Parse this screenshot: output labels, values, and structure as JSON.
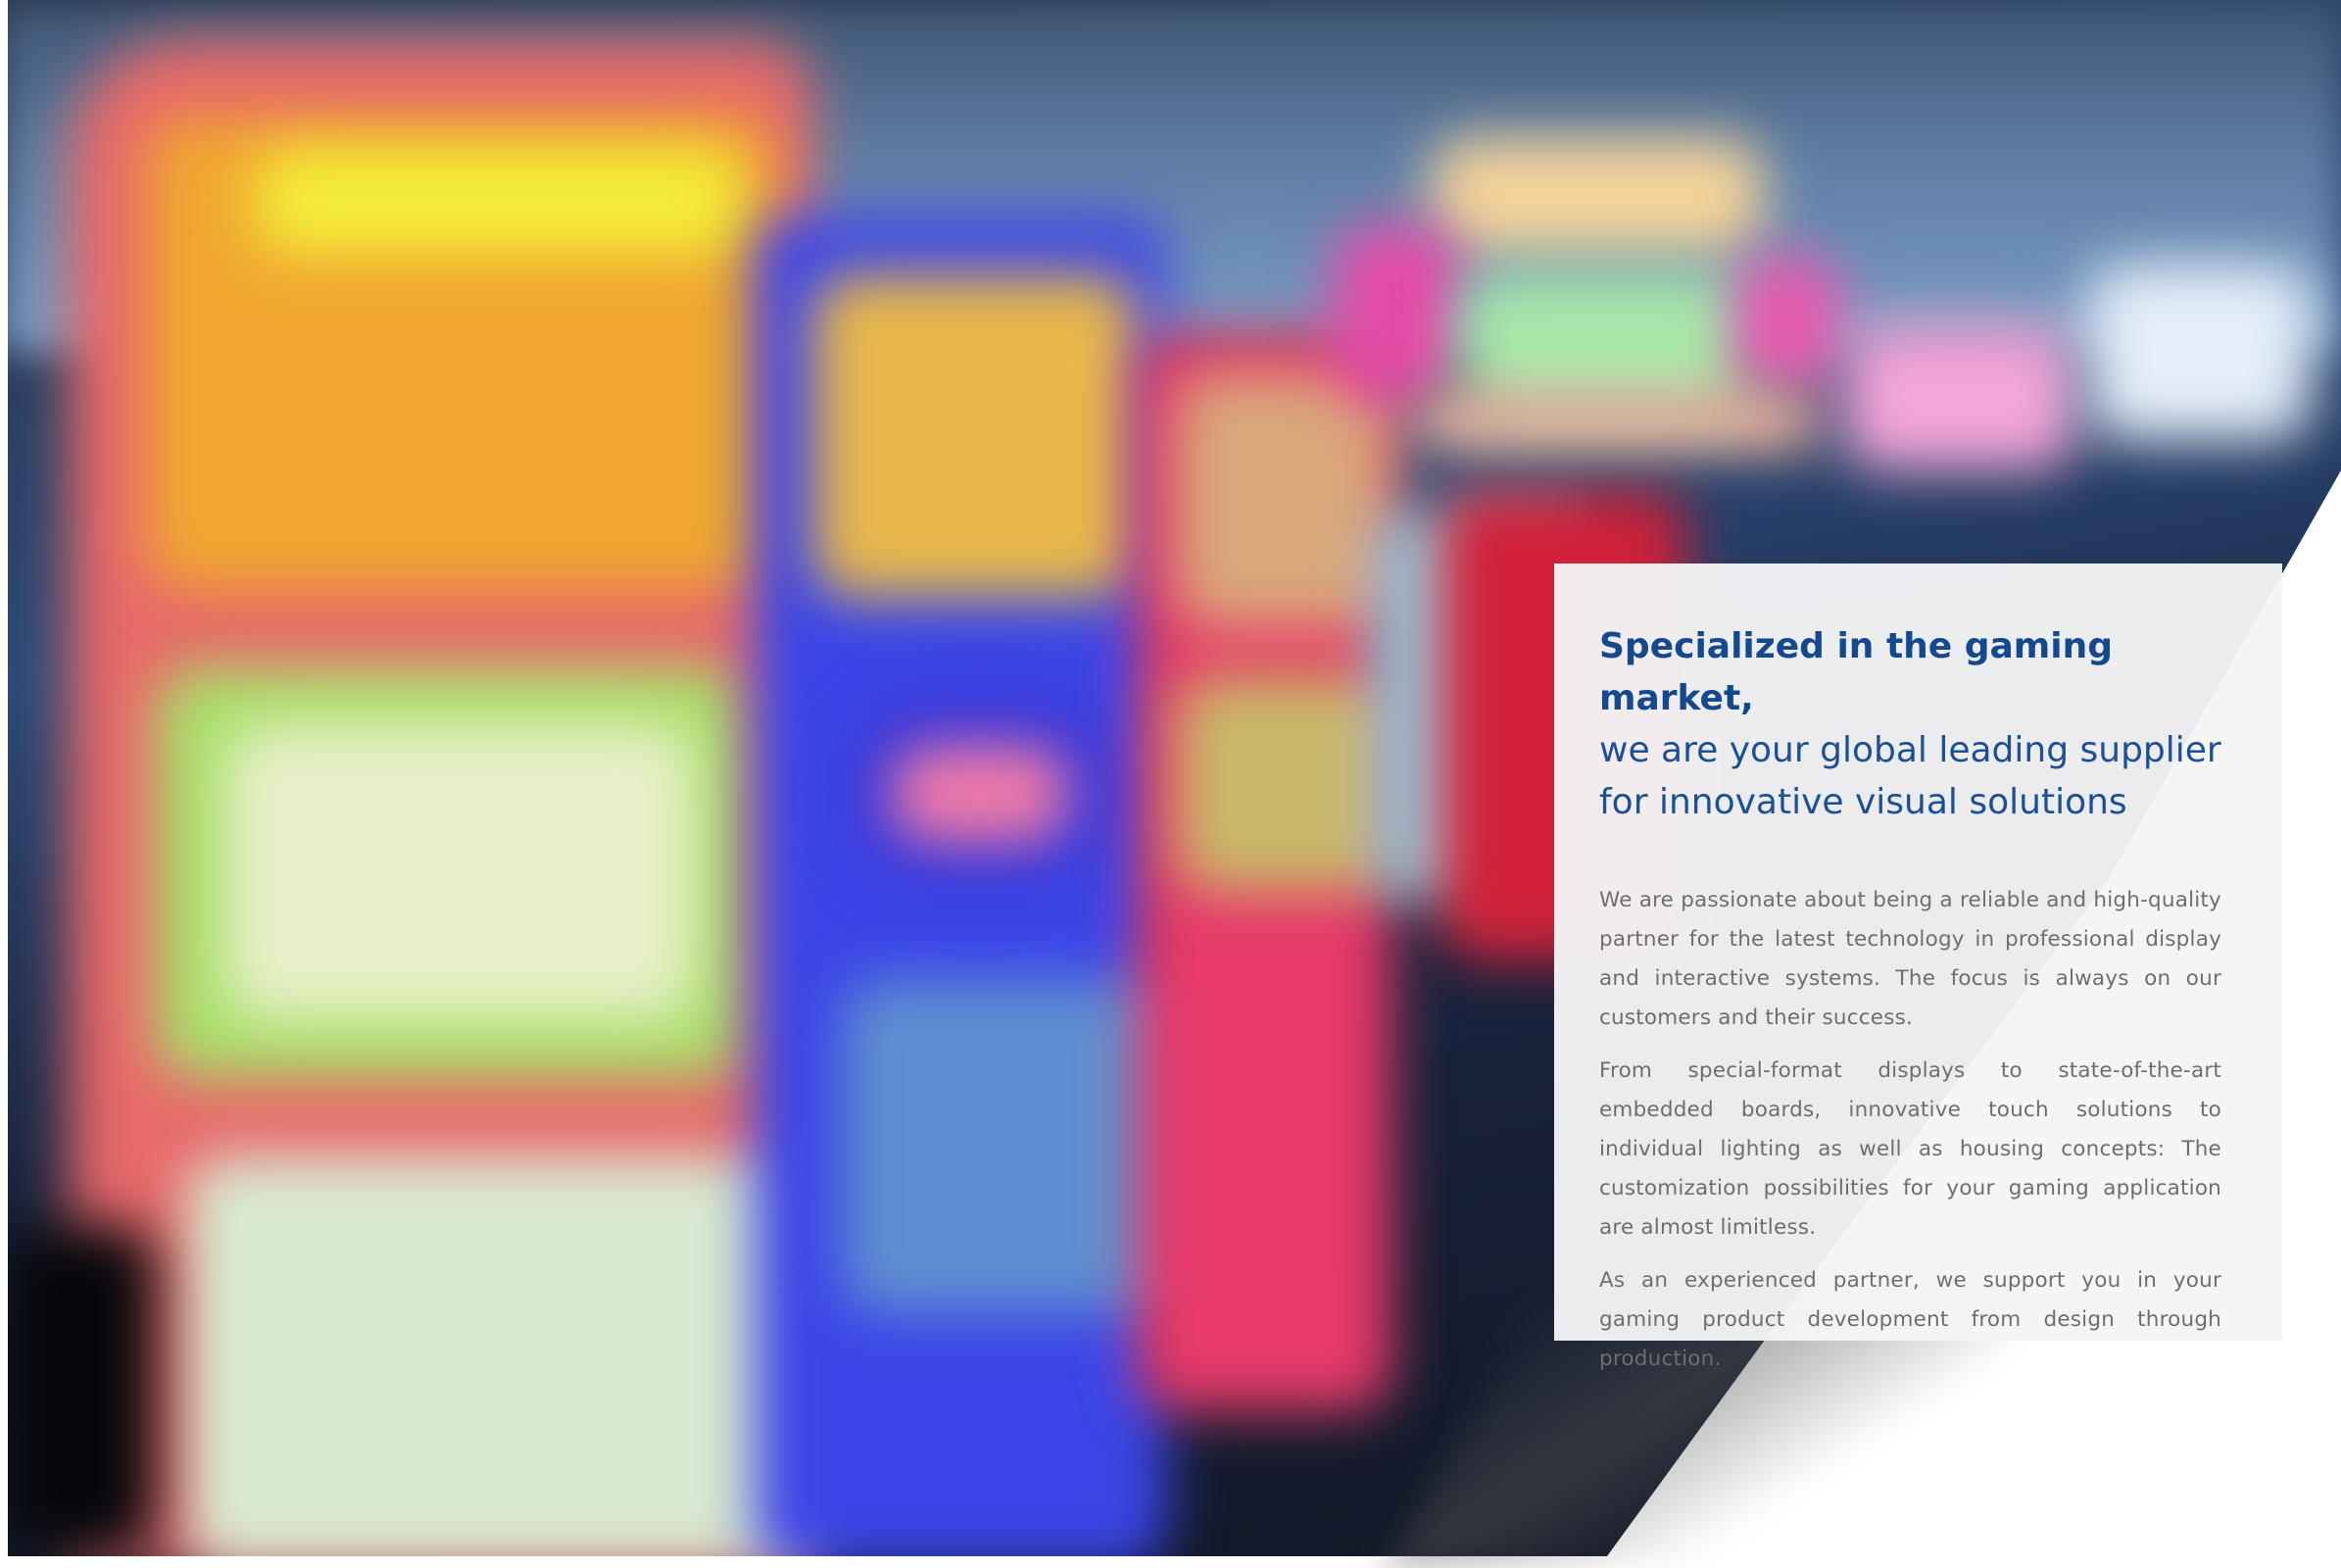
{
  "hero_image": {
    "subject": "blurred-casino-slot-machines-photo"
  },
  "intro": {
    "headline_bold": "Specialized in the gaming market,",
    "headline_line2": "we are your global leading supplier",
    "headline_line3": "for innovative visual solutions",
    "paragraphs": [
      "We are passionate about being a reliable and high-quality partner for the latest technology in professional display and interactive systems. The focus is always on our customers and their success.",
      "From special-format displays to state-of-the-art embedded boards, innovative touch solutions to individual lighting as well as housing concepts: The customization possibilities for your gaming application are almost limitless.",
      "As an experienced partner, we support you in your gaming product development from design through production."
    ]
  },
  "colors": {
    "headline_blue": "#1b4f96",
    "body_gray": "#6d6e72",
    "panel_bg": "#f5f5f6"
  }
}
